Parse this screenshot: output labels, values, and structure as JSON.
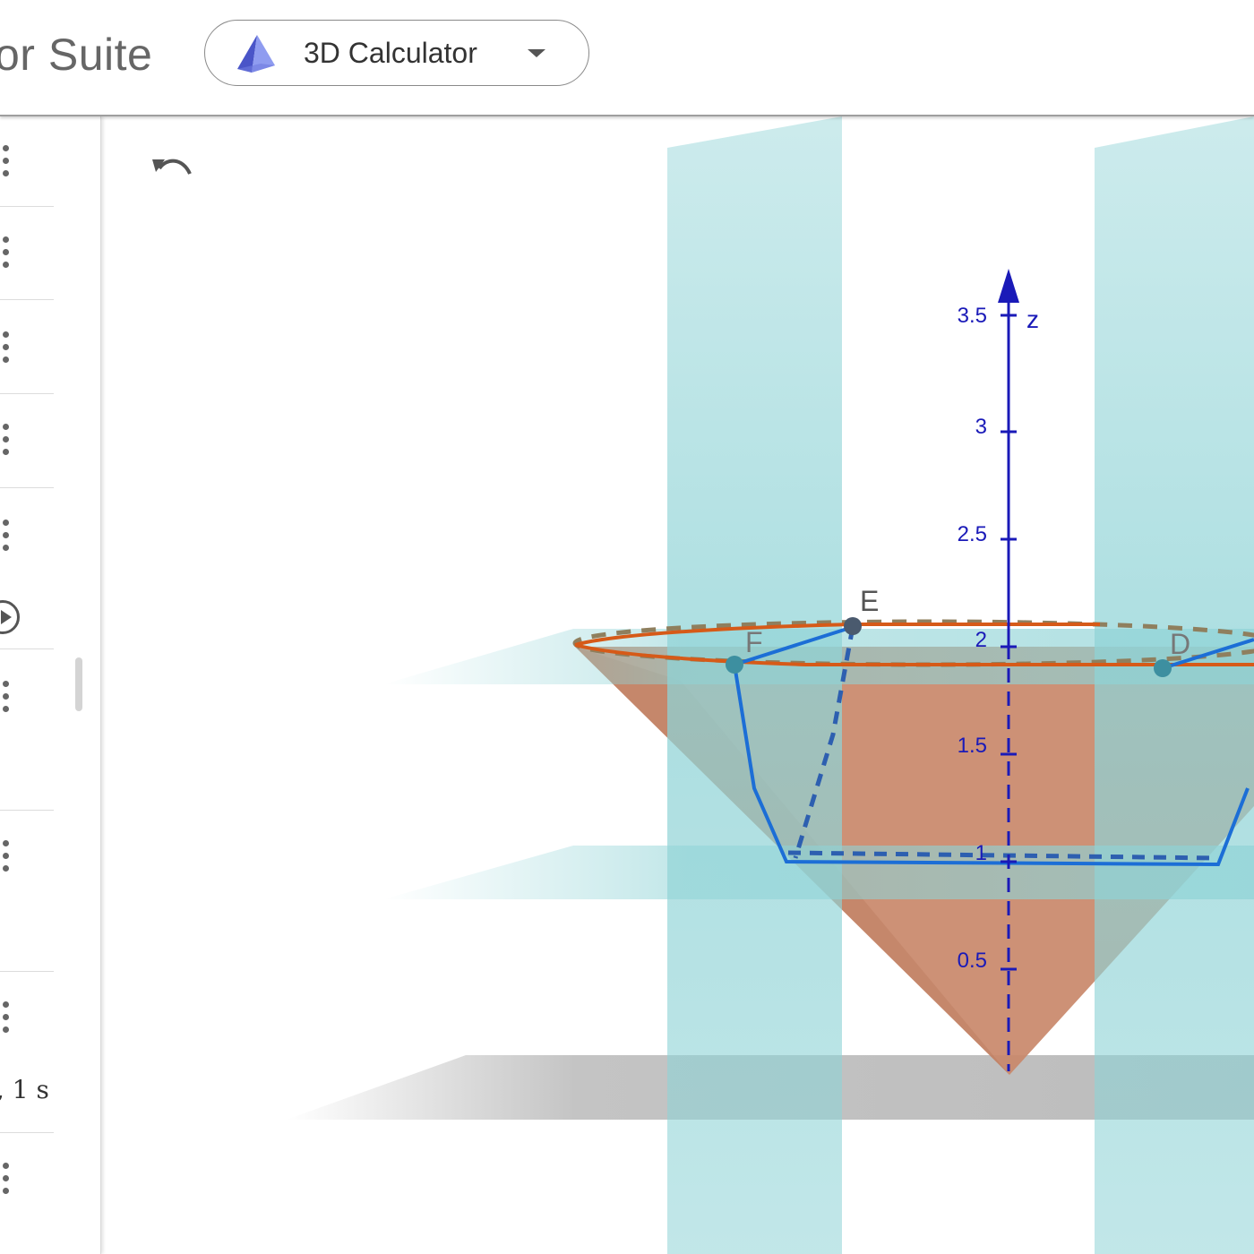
{
  "header": {
    "app_title": "or Suite",
    "app_switcher": {
      "label": "3D Calculator",
      "icon": "pyramid-icon"
    }
  },
  "algebra_view": {
    "rows": [
      {
        "menu_icon": "more-vert-icon"
      },
      {
        "menu_icon": "more-vert-icon"
      },
      {
        "menu_icon": "more-vert-icon"
      },
      {
        "menu_icon": "more-vert-icon"
      },
      {
        "menu_icon": "more-vert-icon",
        "play_icon": "play-circle-icon"
      },
      {
        "menu_icon": "more-vert-icon"
      },
      {
        "menu_icon": "more-vert-icon"
      },
      {
        "menu_icon": "more-vert-icon",
        "text": ", 1 s"
      },
      {
        "menu_icon": "more-vert-icon"
      }
    ]
  },
  "graphics_3d": {
    "undo_icon": "undo-icon",
    "z_axis": {
      "label": "z",
      "ticks": [
        "0.5",
        "1",
        "1.5",
        "2",
        "2.5",
        "3",
        "3.5"
      ]
    },
    "points": [
      "E",
      "F",
      "D"
    ],
    "colors": {
      "axis": "#1a1ab8",
      "cone": "#c9886a",
      "plane": "#8fd3d6",
      "ground_plane": "#b5b5b5",
      "circle": "#d65a18",
      "path": "#1c6ed6"
    }
  }
}
